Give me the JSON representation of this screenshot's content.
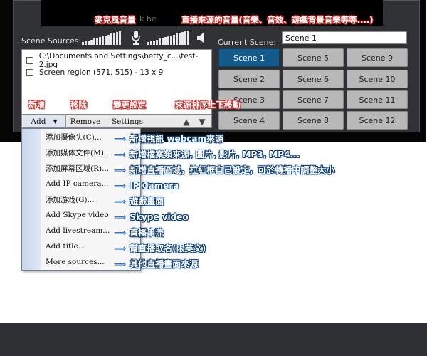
{
  "annotations": {
    "mic_volume": "麥克風音量",
    "stream_volume": "直播來源的音量(音樂、音效、遊戲背景音樂等等....)",
    "add": "新增",
    "remove": "移除",
    "settings": "變更設定",
    "reorder": "來源排序上下移動",
    "menu": [
      "新增視訊 webcam來源",
      "新增檔案類來源, 圖片, 影片, MP3, MP4...",
      "新增直播區域，拉紅框自己設定，可於轉播中調整大小",
      "IP Camera",
      "遊戲畫面",
      "Skype video",
      "直播串流",
      "幫直播取名(限英文)",
      "其他直播畫面來源"
    ]
  },
  "preview_fragment": "k he",
  "labels": {
    "scene_sources": "Scene Sources:",
    "current_scene": "Current Scene:"
  },
  "current_scene_value": "Scene 1",
  "scenes": [
    "Scene 1",
    "Scene 5",
    "Scene 9",
    "Scene 2",
    "Scene 6",
    "Scene 10",
    "Scene 3",
    "Scene 7",
    "Scene 11",
    "Scene 4",
    "Scene 8",
    "Scene 12"
  ],
  "sources": [
    "C:\\Documents and Settings\\betty_c...\\test-2.jpg",
    "Screen region (571, 515) - 13 x 9"
  ],
  "toolbar": {
    "add": "Add",
    "remove": "Remove",
    "settings": "Settings",
    "dropdown_icon": "chevron-down-icon",
    "up_icon": "arrow-up-icon",
    "down_icon": "arrow-down-icon"
  },
  "menu": [
    "添加摄像头(C)...",
    "添加媒体文件(M)...",
    "添加屏幕区域(R)...",
    "Add IP camera...",
    "添加游戏(G)...",
    "Add Skype video",
    "Add livestream...",
    "Add title...",
    "More sources..."
  ],
  "colors": {
    "active_scene": "#145a8a",
    "annotation_red": "#c52222",
    "annotation_blue": "#0a3a6e",
    "arrow": "#1d63b3"
  }
}
